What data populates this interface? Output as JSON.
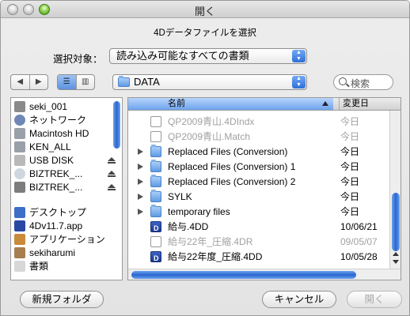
{
  "window": {
    "title": "開く"
  },
  "prompt": "4Dデータファイルを選択",
  "filter": {
    "label": "選択対象：",
    "value": "読み込み可能なすべての書類"
  },
  "location": {
    "value": "DATA"
  },
  "search": {
    "placeholder": "検索"
  },
  "sidebar": {
    "items": [
      {
        "label": "seki_001",
        "icon": "computer-icon",
        "eject": false
      },
      {
        "label": "ネットワーク",
        "icon": "network-icon",
        "eject": false
      },
      {
        "label": "Macintosh HD",
        "icon": "hard-disk-icon",
        "eject": false
      },
      {
        "label": "KEN_ALL",
        "icon": "hard-disk-icon",
        "eject": false
      },
      {
        "label": "USB DISK",
        "icon": "usb-disk-icon",
        "eject": true
      },
      {
        "label": "BIZTREK_...",
        "icon": "cd-icon",
        "eject": true
      },
      {
        "label": "BIZTREK_...",
        "icon": "drive-icon",
        "eject": true
      },
      {
        "label": "デスクトップ",
        "icon": "desktop-icon",
        "eject": false
      },
      {
        "label": "4Dv11.7.app",
        "icon": "app-icon",
        "eject": false
      },
      {
        "label": "アプリケーション",
        "icon": "applications-icon",
        "eject": false
      },
      {
        "label": "sekiharumi",
        "icon": "home-icon",
        "eject": false
      },
      {
        "label": "書類",
        "icon": "documents-icon",
        "eject": false
      }
    ]
  },
  "filelist": {
    "col_name": "名前",
    "col_date": "変更日",
    "rows": [
      {
        "name": "QP2009青山.4DIndx",
        "date": "今日",
        "kind": "doc",
        "dim": true,
        "folder": false
      },
      {
        "name": "QP2009青山.Match",
        "date": "今日",
        "kind": "doc",
        "dim": true,
        "folder": false
      },
      {
        "name": "Replaced Files (Conversion)",
        "date": "今日",
        "kind": "folder",
        "dim": false,
        "folder": true
      },
      {
        "name": "Replaced Files (Conversion) 1",
        "date": "今日",
        "kind": "folder",
        "dim": false,
        "folder": true
      },
      {
        "name": "Replaced Files (Conversion) 2",
        "date": "今日",
        "kind": "folder",
        "dim": false,
        "folder": true
      },
      {
        "name": "SYLK",
        "date": "今日",
        "kind": "folder",
        "dim": false,
        "folder": true
      },
      {
        "name": "temporary files",
        "date": "今日",
        "kind": "folder",
        "dim": false,
        "folder": true
      },
      {
        "name": "給与.4DD",
        "date": "10/06/21",
        "kind": "doc4d",
        "dim": false,
        "folder": false
      },
      {
        "name": "給与22年_圧縮.4DR",
        "date": "09/05/07",
        "kind": "doc",
        "dim": true,
        "folder": false
      },
      {
        "name": "給与22年度_圧縮.4DD",
        "date": "10/05/28",
        "kind": "doc4d",
        "dim": false,
        "folder": false
      }
    ]
  },
  "buttons": {
    "new_folder": "新規フォルダ",
    "cancel": "キャンセル",
    "open": "開く"
  }
}
